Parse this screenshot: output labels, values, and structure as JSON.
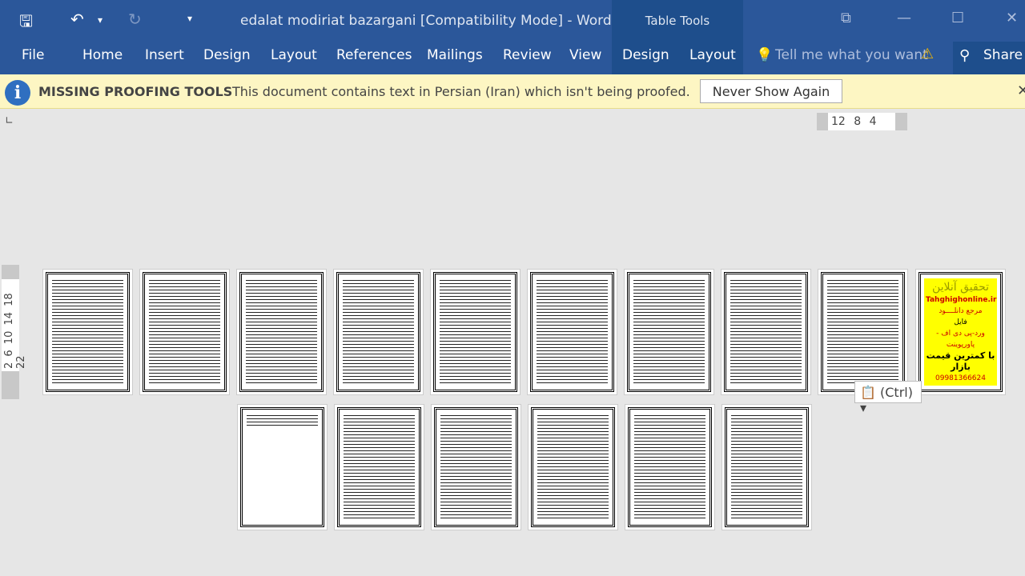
{
  "title": "edalat modiriat bazargani [Compatibility Mode] - Word",
  "table_tools": "Table Tools",
  "quick_access": {
    "save": "🖫",
    "undo": "↶",
    "redo": "↻",
    "customize": "▾"
  },
  "tabs": [
    "File",
    "Home",
    "Insert",
    "Design",
    "Layout",
    "References",
    "Mailings",
    "Review",
    "View",
    "Design",
    "Layout"
  ],
  "tell_me": "Tell me what you want",
  "share": "Share",
  "proofing": {
    "heading": "MISSING PROOFING TOOLS",
    "message": "This document contains text in Persian (Iran) which isn't being proofed.",
    "button": "Never Show Again"
  },
  "ruler": {
    "horizontal": "12 8 4",
    "vertical": "2 6 10 14 18 22"
  },
  "ad": {
    "title": "تحقیق آنلاین",
    "site": "Tahghighonline.ir",
    "line1": "مرجع دانلــــود",
    "line2": "فایل",
    "line3": "ورد-پی دی اف - پاورپوینت",
    "line4": "با کمترین قیمت بازار",
    "line5": "09981366624 واتساپ"
  },
  "paste_options": "(Ctrl)"
}
